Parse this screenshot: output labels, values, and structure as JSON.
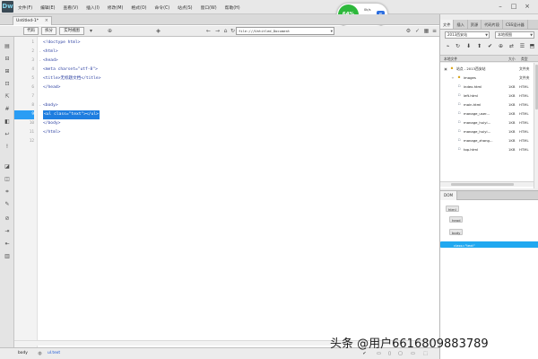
{
  "app": {
    "logo": "Dw"
  },
  "menubar": {
    "items": [
      "文件(F)",
      "编辑(E)",
      "查看(V)",
      "插入(I)",
      "修改(M)",
      "格式(O)",
      "命令(C)",
      "站点(S)",
      "窗口(W)",
      "帮助(H)"
    ]
  },
  "perf": {
    "percent": "64%",
    "up": "0k/s",
    "down": "0k/s",
    "badge": "e"
  },
  "window": {
    "minimize": "–",
    "maximize": "□",
    "close": "×"
  },
  "document": {
    "tab_title": "Untitled-1*",
    "tab_close": "×",
    "views": [
      "代码",
      "拆分",
      "实时视图"
    ],
    "address": "file:///Untitled_Document",
    "address_arrow": "▼"
  },
  "code": {
    "lines": [
      "<!doctype html>",
      "<html>",
      "<head>",
      "<meta charset=\"utf-8\">",
      "<title>无标题文档</title>",
      "</head>",
      "",
      "<body>",
      "<ul class=\"text\"></ul>",
      "</body>",
      "</html>",
      ""
    ],
    "active_line": "9",
    "line_numbers": [
      "1",
      "2",
      "3",
      "4",
      "5",
      "6",
      "7",
      "8",
      "9",
      "10",
      "11",
      "12"
    ]
  },
  "statusbar": {
    "tag_body": "body",
    "tag_ul": "ul.text"
  },
  "right_panel": {
    "tabs": [
      "文件",
      "插入",
      "资源",
      "代码片段",
      "CSS设计器"
    ],
    "site_select": "2013西安站",
    "view_select": "本地视图",
    "columns": {
      "name": "本地文件",
      "size": "大小",
      "type": "类型"
    },
    "tree": [
      {
        "indent": 0,
        "glyph": "▣",
        "icon": "▪",
        "name": "站点 - 2013西安站",
        "size": "",
        "type": "文件夹"
      },
      {
        "indent": 1,
        "glyph": "+",
        "icon": "▪",
        "name": "images",
        "size": "",
        "type": "文件夹"
      },
      {
        "indent": 1,
        "glyph": "",
        "icon": "▫",
        "name": "index.html",
        "size": "1KB",
        "type": "HTML"
      },
      {
        "indent": 1,
        "glyph": "",
        "icon": "▫",
        "name": "left.html",
        "size": "1KB",
        "type": "HTML"
      },
      {
        "indent": 1,
        "glyph": "",
        "icon": "▫",
        "name": "main.html",
        "size": "1KB",
        "type": "HTML"
      },
      {
        "indent": 1,
        "glyph": "",
        "icon": "▫",
        "name": "manage_user...",
        "size": "1KB",
        "type": "HTML"
      },
      {
        "indent": 1,
        "glyph": "",
        "icon": "▫",
        "name": "manage_huiyi...",
        "size": "1KB",
        "type": "HTML"
      },
      {
        "indent": 1,
        "glyph": "",
        "icon": "▫",
        "name": "manage_huiyi...",
        "size": "1KB",
        "type": "HTML"
      },
      {
        "indent": 1,
        "glyph": "",
        "icon": "▫",
        "name": "manage_zhang...",
        "size": "1KB",
        "type": "HTML"
      },
      {
        "indent": 1,
        "glyph": "",
        "icon": "▫",
        "name": "top.html",
        "size": "1KB",
        "type": "HTML"
      }
    ]
  },
  "dom": {
    "tab": "DOM",
    "nodes": [
      {
        "label": "html",
        "selected": false
      },
      {
        "label": "head",
        "selected": false
      },
      {
        "label": "body",
        "selected": false
      },
      {
        "label": "class=\"text\"",
        "selected": true
      }
    ]
  },
  "watermark": "头条 @用户6616809883789"
}
